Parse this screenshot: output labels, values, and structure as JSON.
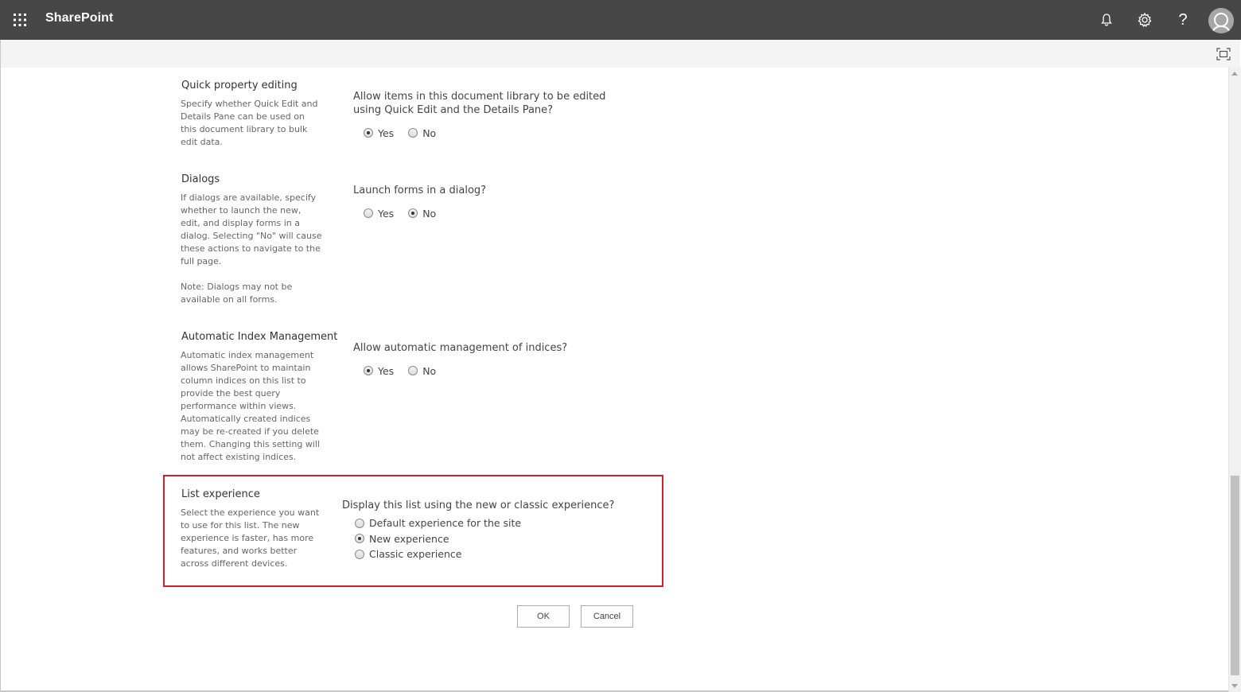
{
  "suitebar": {
    "brand": "SharePoint",
    "icons": [
      "waffle-icon",
      "bell-icon",
      "gear-icon",
      "help-icon",
      "avatar"
    ],
    "help_glyph": "?"
  },
  "sections": {
    "quick_edit": {
      "title": "Quick property editing",
      "description": "Specify whether Quick Edit and Details Pane can be used on this document library to bulk edit data.",
      "question": "Allow items in this document library to be edited using Quick Edit and the Details Pane?",
      "options": [
        "Yes",
        "No"
      ],
      "selected": "Yes"
    },
    "dialogs": {
      "title": "Dialogs",
      "description": "If dialogs are available, specify whether to launch the new, edit, and display forms in a dialog. Selecting \"No\" will cause these actions to navigate to the full page.",
      "note": "Note: Dialogs may not be available on all forms.",
      "question": "Launch forms in a dialog?",
      "options": [
        "Yes",
        "No"
      ],
      "selected": "No"
    },
    "index": {
      "title": "Automatic Index Management",
      "description": "Automatic index management allows SharePoint to maintain column indices on this list to provide the best query performance within views. Automatically created indices may be re-created if you delete them. Changing this setting will not affect existing indices.",
      "question": "Allow automatic management of indices?",
      "options": [
        "Yes",
        "No"
      ],
      "selected": "Yes"
    },
    "list_experience": {
      "title": "List experience",
      "description": "Select the experience you want to use for this list. The new experience is faster, has more features, and works better across different devices.",
      "question": "Display this list using the new or classic experience?",
      "options": [
        "Default experience for the site",
        "New experience",
        "Classic experience"
      ],
      "selected": "New experience"
    }
  },
  "buttons": {
    "ok": "OK",
    "cancel": "Cancel"
  },
  "colors": {
    "suitebar_bg": "#474747",
    "highlight_border": "#d0202e"
  }
}
